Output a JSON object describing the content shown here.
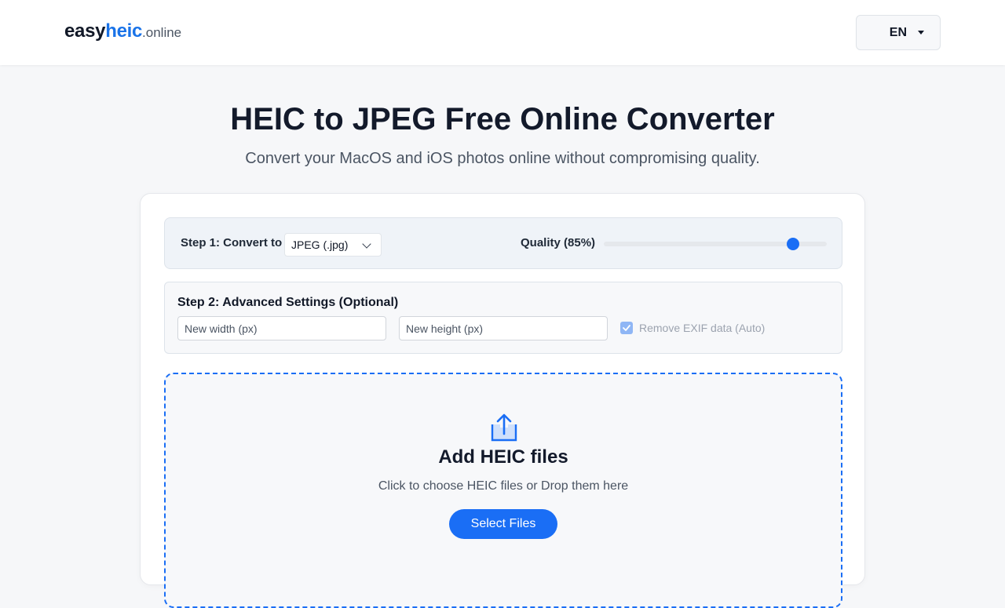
{
  "header": {
    "logo": {
      "part1": "easy",
      "part2": "heic",
      "part3": ".online"
    },
    "language": {
      "label": "EN",
      "icon": "caret-down-icon"
    }
  },
  "hero": {
    "title": "HEIC to JPEG Free Online Converter",
    "subtitle": "Convert your MacOS and iOS photos online without compromising quality."
  },
  "step1": {
    "label": "Step 1: Convert to",
    "format_value": "JPEG (.jpg)",
    "quality_label": "Quality (85%)",
    "quality_value": 0.85
  },
  "step2": {
    "label": "Step 2: Advanced Settings (Optional)",
    "width_placeholder": "New width (px)",
    "height_placeholder": "New height (px)",
    "exif_label": "Remove EXIF data (Auto)",
    "exif_checked": true
  },
  "dropzone": {
    "icon": "upload-icon",
    "title": "Add HEIC files",
    "subtitle": "Click to choose HEIC files or Drop them here",
    "button_label": "Select Files"
  },
  "colors": {
    "accent": "#1a6ef5",
    "brand": "#1a73e8",
    "text": "#131a2b"
  }
}
